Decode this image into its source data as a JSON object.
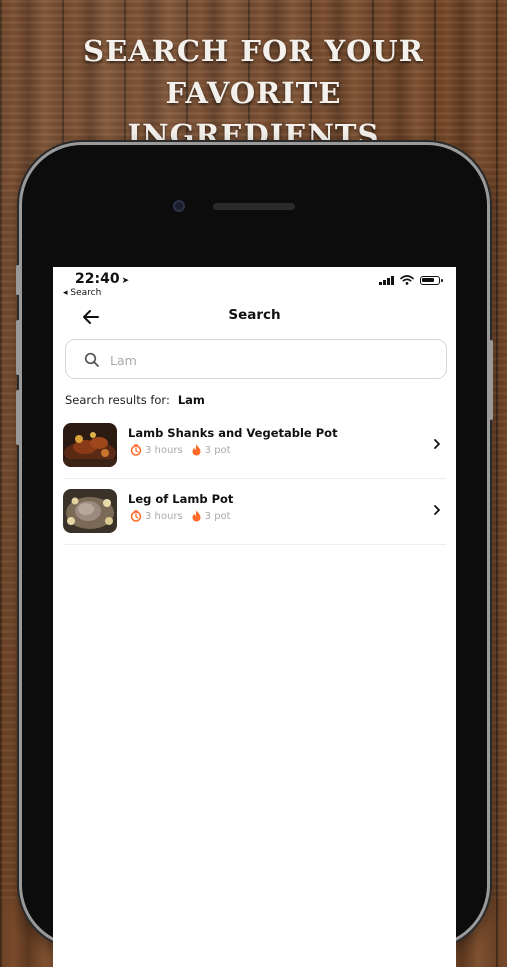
{
  "headline": {
    "line1": "SEARCH FOR YOUR FAVORITE",
    "line2": "INGREDIENTS"
  },
  "status_bar": {
    "time": "22:40",
    "back_app_label": "◂ Search"
  },
  "nav": {
    "title": "Search"
  },
  "search": {
    "value": "Lam"
  },
  "results": {
    "label": "Search results for:",
    "query": "Lam",
    "items": [
      {
        "title": "Lamb Shanks and Vegetable Pot",
        "time": "3 hours",
        "pot": "3 pot"
      },
      {
        "title": "Leg of Lamb Pot",
        "time": "3 hours",
        "pot": "3 pot"
      }
    ]
  },
  "colors": {
    "accent": "#ff6a2b",
    "text": "#111111",
    "muted": "#aaaaaa"
  },
  "icons": [
    "back-arrow-icon",
    "search-icon",
    "timer-icon",
    "flame-icon",
    "chevron-right-icon",
    "signal-icon",
    "wifi-icon",
    "battery-icon",
    "location-arrow-icon"
  ]
}
